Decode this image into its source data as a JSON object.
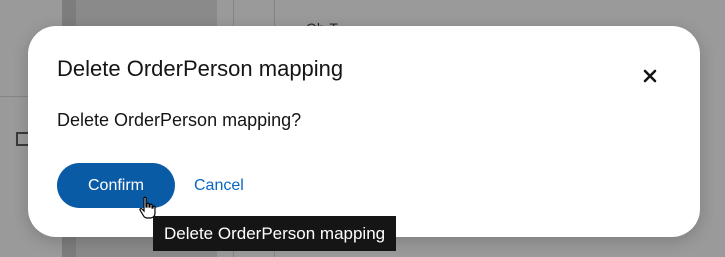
{
  "background": {
    "partial_text": "Ob·T"
  },
  "dialog": {
    "title": "Delete OrderPerson mapping",
    "message": "Delete OrderPerson mapping?",
    "confirm_label": "Confirm",
    "cancel_label": "Cancel",
    "close_icon": "close-icon"
  },
  "tooltip": {
    "text": "Delete OrderPerson mapping"
  },
  "colors": {
    "primary": "#0a5ba6",
    "link": "#0a66c2",
    "tooltip_bg": "#151515"
  }
}
